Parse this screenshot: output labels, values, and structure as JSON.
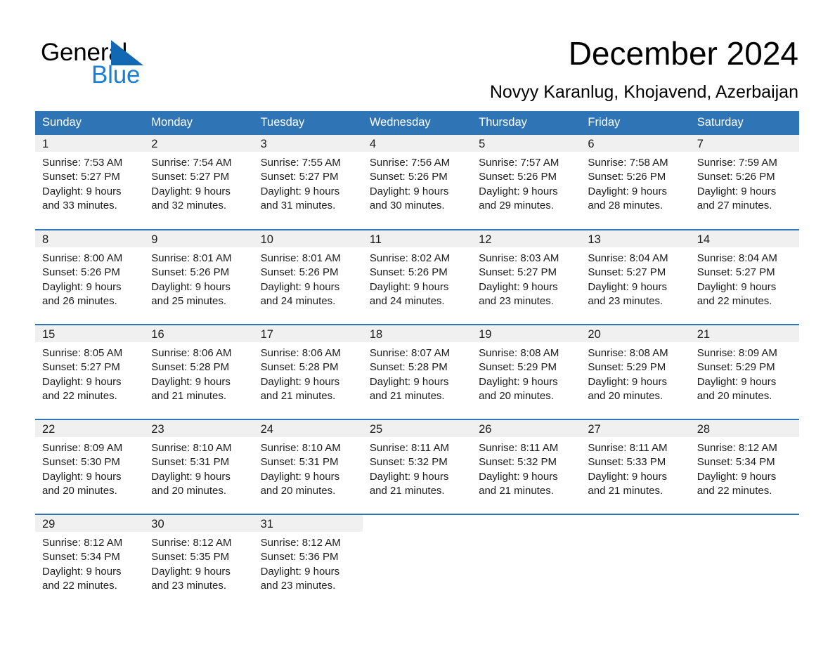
{
  "brand": {
    "name_part1": "General",
    "name_part2": "Blue",
    "logo_icon": "triangle-mark",
    "accent_color": "#1a7fd4"
  },
  "header": {
    "title": "December 2024",
    "subtitle": "Novyy Karanlug, Khojavend, Azerbaijan"
  },
  "theme": {
    "header_blue": "#2f74b5",
    "daynum_gray": "#f0f0f0",
    "text_black": "#1c1c1c"
  },
  "weekday_headers": [
    "Sunday",
    "Monday",
    "Tuesday",
    "Wednesday",
    "Thursday",
    "Friday",
    "Saturday"
  ],
  "weeks": [
    [
      {
        "day": "1",
        "sunrise": "Sunrise: 7:53 AM",
        "sunset": "Sunset: 5:27 PM",
        "daylight1": "Daylight: 9 hours",
        "daylight2": "and 33 minutes."
      },
      {
        "day": "2",
        "sunrise": "Sunrise: 7:54 AM",
        "sunset": "Sunset: 5:27 PM",
        "daylight1": "Daylight: 9 hours",
        "daylight2": "and 32 minutes."
      },
      {
        "day": "3",
        "sunrise": "Sunrise: 7:55 AM",
        "sunset": "Sunset: 5:27 PM",
        "daylight1": "Daylight: 9 hours",
        "daylight2": "and 31 minutes."
      },
      {
        "day": "4",
        "sunrise": "Sunrise: 7:56 AM",
        "sunset": "Sunset: 5:26 PM",
        "daylight1": "Daylight: 9 hours",
        "daylight2": "and 30 minutes."
      },
      {
        "day": "5",
        "sunrise": "Sunrise: 7:57 AM",
        "sunset": "Sunset: 5:26 PM",
        "daylight1": "Daylight: 9 hours",
        "daylight2": "and 29 minutes."
      },
      {
        "day": "6",
        "sunrise": "Sunrise: 7:58 AM",
        "sunset": "Sunset: 5:26 PM",
        "daylight1": "Daylight: 9 hours",
        "daylight2": "and 28 minutes."
      },
      {
        "day": "7",
        "sunrise": "Sunrise: 7:59 AM",
        "sunset": "Sunset: 5:26 PM",
        "daylight1": "Daylight: 9 hours",
        "daylight2": "and 27 minutes."
      }
    ],
    [
      {
        "day": "8",
        "sunrise": "Sunrise: 8:00 AM",
        "sunset": "Sunset: 5:26 PM",
        "daylight1": "Daylight: 9 hours",
        "daylight2": "and 26 minutes."
      },
      {
        "day": "9",
        "sunrise": "Sunrise: 8:01 AM",
        "sunset": "Sunset: 5:26 PM",
        "daylight1": "Daylight: 9 hours",
        "daylight2": "and 25 minutes."
      },
      {
        "day": "10",
        "sunrise": "Sunrise: 8:01 AM",
        "sunset": "Sunset: 5:26 PM",
        "daylight1": "Daylight: 9 hours",
        "daylight2": "and 24 minutes."
      },
      {
        "day": "11",
        "sunrise": "Sunrise: 8:02 AM",
        "sunset": "Sunset: 5:26 PM",
        "daylight1": "Daylight: 9 hours",
        "daylight2": "and 24 minutes."
      },
      {
        "day": "12",
        "sunrise": "Sunrise: 8:03 AM",
        "sunset": "Sunset: 5:27 PM",
        "daylight1": "Daylight: 9 hours",
        "daylight2": "and 23 minutes."
      },
      {
        "day": "13",
        "sunrise": "Sunrise: 8:04 AM",
        "sunset": "Sunset: 5:27 PM",
        "daylight1": "Daylight: 9 hours",
        "daylight2": "and 23 minutes."
      },
      {
        "day": "14",
        "sunrise": "Sunrise: 8:04 AM",
        "sunset": "Sunset: 5:27 PM",
        "daylight1": "Daylight: 9 hours",
        "daylight2": "and 22 minutes."
      }
    ],
    [
      {
        "day": "15",
        "sunrise": "Sunrise: 8:05 AM",
        "sunset": "Sunset: 5:27 PM",
        "daylight1": "Daylight: 9 hours",
        "daylight2": "and 22 minutes."
      },
      {
        "day": "16",
        "sunrise": "Sunrise: 8:06 AM",
        "sunset": "Sunset: 5:28 PM",
        "daylight1": "Daylight: 9 hours",
        "daylight2": "and 21 minutes."
      },
      {
        "day": "17",
        "sunrise": "Sunrise: 8:06 AM",
        "sunset": "Sunset: 5:28 PM",
        "daylight1": "Daylight: 9 hours",
        "daylight2": "and 21 minutes."
      },
      {
        "day": "18",
        "sunrise": "Sunrise: 8:07 AM",
        "sunset": "Sunset: 5:28 PM",
        "daylight1": "Daylight: 9 hours",
        "daylight2": "and 21 minutes."
      },
      {
        "day": "19",
        "sunrise": "Sunrise: 8:08 AM",
        "sunset": "Sunset: 5:29 PM",
        "daylight1": "Daylight: 9 hours",
        "daylight2": "and 20 minutes."
      },
      {
        "day": "20",
        "sunrise": "Sunrise: 8:08 AM",
        "sunset": "Sunset: 5:29 PM",
        "daylight1": "Daylight: 9 hours",
        "daylight2": "and 20 minutes."
      },
      {
        "day": "21",
        "sunrise": "Sunrise: 8:09 AM",
        "sunset": "Sunset: 5:29 PM",
        "daylight1": "Daylight: 9 hours",
        "daylight2": "and 20 minutes."
      }
    ],
    [
      {
        "day": "22",
        "sunrise": "Sunrise: 8:09 AM",
        "sunset": "Sunset: 5:30 PM",
        "daylight1": "Daylight: 9 hours",
        "daylight2": "and 20 minutes."
      },
      {
        "day": "23",
        "sunrise": "Sunrise: 8:10 AM",
        "sunset": "Sunset: 5:31 PM",
        "daylight1": "Daylight: 9 hours",
        "daylight2": "and 20 minutes."
      },
      {
        "day": "24",
        "sunrise": "Sunrise: 8:10 AM",
        "sunset": "Sunset: 5:31 PM",
        "daylight1": "Daylight: 9 hours",
        "daylight2": "and 20 minutes."
      },
      {
        "day": "25",
        "sunrise": "Sunrise: 8:11 AM",
        "sunset": "Sunset: 5:32 PM",
        "daylight1": "Daylight: 9 hours",
        "daylight2": "and 21 minutes."
      },
      {
        "day": "26",
        "sunrise": "Sunrise: 8:11 AM",
        "sunset": "Sunset: 5:32 PM",
        "daylight1": "Daylight: 9 hours",
        "daylight2": "and 21 minutes."
      },
      {
        "day": "27",
        "sunrise": "Sunrise: 8:11 AM",
        "sunset": "Sunset: 5:33 PM",
        "daylight1": "Daylight: 9 hours",
        "daylight2": "and 21 minutes."
      },
      {
        "day": "28",
        "sunrise": "Sunrise: 8:12 AM",
        "sunset": "Sunset: 5:34 PM",
        "daylight1": "Daylight: 9 hours",
        "daylight2": "and 22 minutes."
      }
    ],
    [
      {
        "day": "29",
        "sunrise": "Sunrise: 8:12 AM",
        "sunset": "Sunset: 5:34 PM",
        "daylight1": "Daylight: 9 hours",
        "daylight2": "and 22 minutes."
      },
      {
        "day": "30",
        "sunrise": "Sunrise: 8:12 AM",
        "sunset": "Sunset: 5:35 PM",
        "daylight1": "Daylight: 9 hours",
        "daylight2": "and 23 minutes."
      },
      {
        "day": "31",
        "sunrise": "Sunrise: 8:12 AM",
        "sunset": "Sunset: 5:36 PM",
        "daylight1": "Daylight: 9 hours",
        "daylight2": "and 23 minutes."
      },
      {
        "day": "",
        "sunrise": "",
        "sunset": "",
        "daylight1": "",
        "daylight2": ""
      },
      {
        "day": "",
        "sunrise": "",
        "sunset": "",
        "daylight1": "",
        "daylight2": ""
      },
      {
        "day": "",
        "sunrise": "",
        "sunset": "",
        "daylight1": "",
        "daylight2": ""
      },
      {
        "day": "",
        "sunrise": "",
        "sunset": "",
        "daylight1": "",
        "daylight2": ""
      }
    ]
  ]
}
